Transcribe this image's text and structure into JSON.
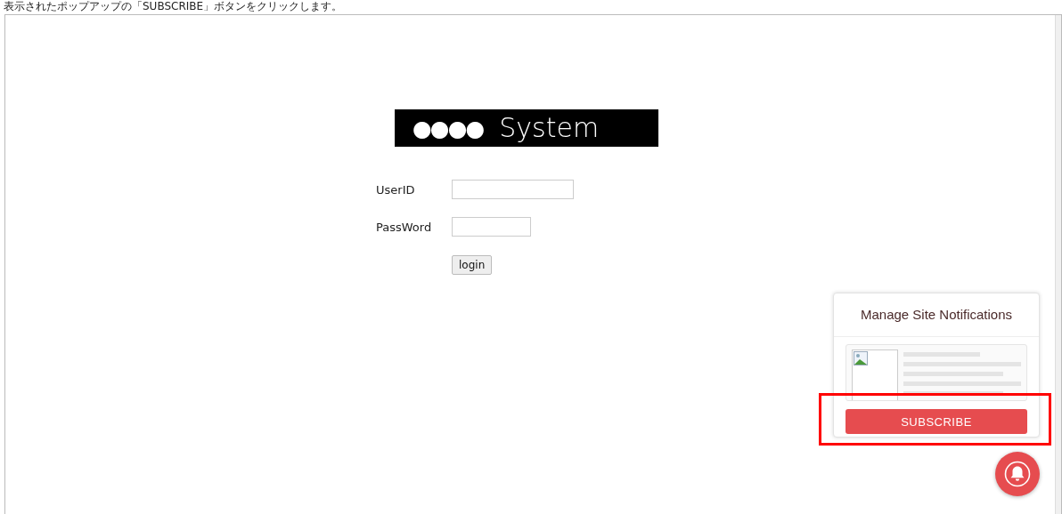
{
  "instruction": "表示されたポップアップの「SUBSCRIBE」ボタンをクリックします。",
  "logo": {
    "dots": "●●●●",
    "text": "System"
  },
  "form": {
    "fields": [
      {
        "label": "UserID",
        "kind": "wide"
      },
      {
        "label": "PassWord",
        "kind": "narrow"
      }
    ],
    "button": "login"
  },
  "notification_panel": {
    "title": "Manage Site Notifications",
    "button": "SUBSCRIBE",
    "highlighted": true
  }
}
